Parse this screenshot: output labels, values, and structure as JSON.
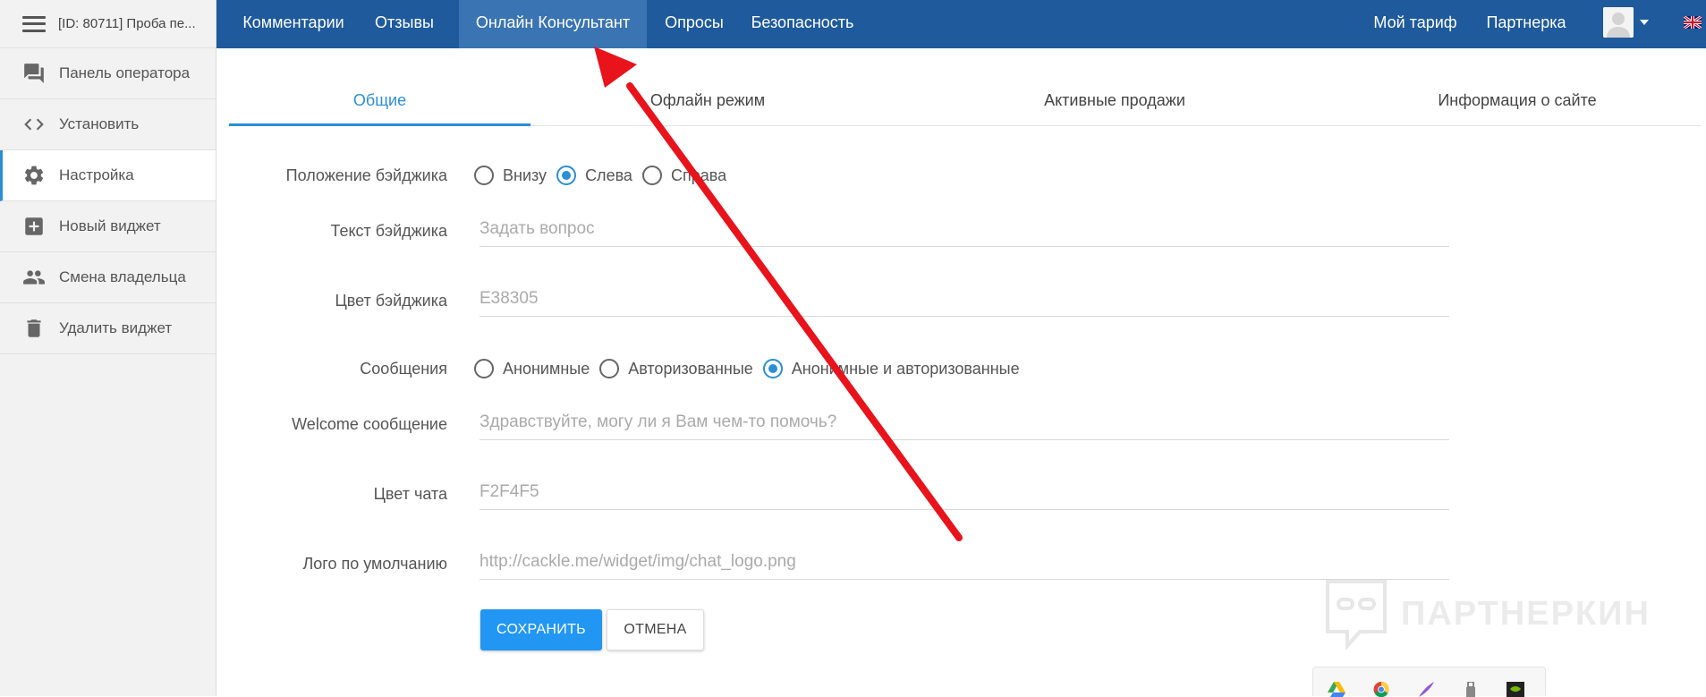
{
  "sidebar": {
    "title": "[ID: 80711] Проба пе...",
    "items": [
      {
        "label": "Панель оператора",
        "icon": "forum-icon"
      },
      {
        "label": "Установить",
        "icon": "code-icon"
      },
      {
        "label": "Настройка",
        "icon": "gear-icon",
        "active": true
      },
      {
        "label": "Новый виджет",
        "icon": "add-box-icon"
      },
      {
        "label": "Смена владельца",
        "icon": "people-icon"
      },
      {
        "label": "Удалить виджет",
        "icon": "trash-icon"
      }
    ]
  },
  "topnav": {
    "items": [
      "Комментарии",
      "Отзывы",
      "Онлайн Консультант",
      "Опросы",
      "Безопасность"
    ],
    "active": "Онлайн Консультант",
    "right": [
      "Мой тариф",
      "Партнерка"
    ]
  },
  "tabs": {
    "items": [
      "Общие",
      "Офлайн режим",
      "Активные продажи",
      "Информация о сайте"
    ],
    "active": "Общие"
  },
  "form": {
    "badge_position": {
      "label": "Положение бэйджика",
      "options": [
        "Внизу",
        "Слева",
        "Справа"
      ],
      "selected": "Слева"
    },
    "badge_text": {
      "label": "Текст бэйджика",
      "placeholder": "Задать вопрос"
    },
    "badge_color": {
      "label": "Цвет бэйджика",
      "placeholder": "E38305"
    },
    "messages": {
      "label": "Сообщения",
      "options": [
        "Анонимные",
        "Авторизованные",
        "Анонимные и авторизованные"
      ],
      "selected": "Анонимные и авторизованные"
    },
    "welcome": {
      "label": "Welcome сообщение",
      "placeholder": "Здравствуйте, могу ли я Вам чем-то помочь?"
    },
    "chat_color": {
      "label": "Цвет чата",
      "placeholder": "F2F4F5"
    },
    "logo": {
      "label": "Лого по умолчанию",
      "placeholder": "http://cackle.me/widget/img/chat_logo.png"
    },
    "save_label": "СОХРАНИТЬ",
    "cancel_label": "ОТМЕНА"
  },
  "watermark": {
    "text": "ПАРТНЕРКИН"
  },
  "colors": {
    "nav": "#1e5a9c",
    "nav_active": "#3a74b3",
    "accent": "#2b8fd6",
    "save_button": "#2196f3",
    "arrow": "#e8131b"
  }
}
